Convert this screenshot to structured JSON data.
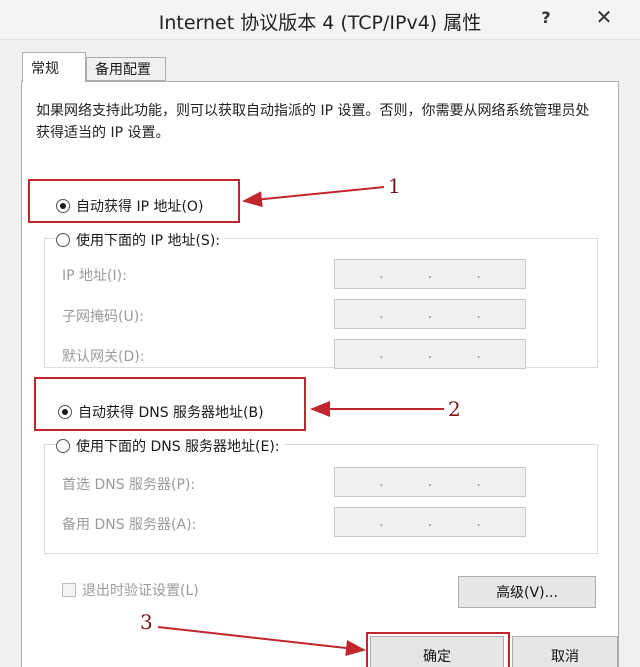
{
  "window": {
    "title": "Internet 协议版本 4 (TCP/IPv4) 属性",
    "help_glyph": "?",
    "close_glyph": "✕"
  },
  "tabs": [
    {
      "label": "常规",
      "active": true
    },
    {
      "label": "备用配置",
      "active": false
    }
  ],
  "description": "如果网络支持此功能，则可以获取自动指派的 IP 设置。否则，你需要从网络系统管理员处获得适当的 IP 设置。",
  "ip_section": {
    "auto_label": "自动获得 IP 地址(O)",
    "manual_label": "使用下面的 IP 地址(S):",
    "selected": "auto",
    "fields": [
      {
        "label": "IP 地址(I):",
        "value": ". . ."
      },
      {
        "label": "子网掩码(U):",
        "value": ". . ."
      },
      {
        "label": "默认网关(D):",
        "value": ". . ."
      }
    ]
  },
  "dns_section": {
    "auto_label": "自动获得 DNS 服务器地址(B)",
    "manual_label": "使用下面的 DNS 服务器地址(E):",
    "selected": "auto",
    "fields": [
      {
        "label": "首选 DNS 服务器(P):",
        "value": ". . ."
      },
      {
        "label": "备用 DNS 服务器(A):",
        "value": ". . ."
      }
    ]
  },
  "validate_on_exit": {
    "label": "退出时验证设置(L)",
    "checked": false,
    "enabled": false
  },
  "buttons": {
    "advanced": "高级(V)...",
    "ok": "确定",
    "cancel": "取消"
  },
  "annotations": {
    "callout_1": "1",
    "callout_2": "2",
    "callout_3": "3",
    "color": "#c0262c"
  }
}
